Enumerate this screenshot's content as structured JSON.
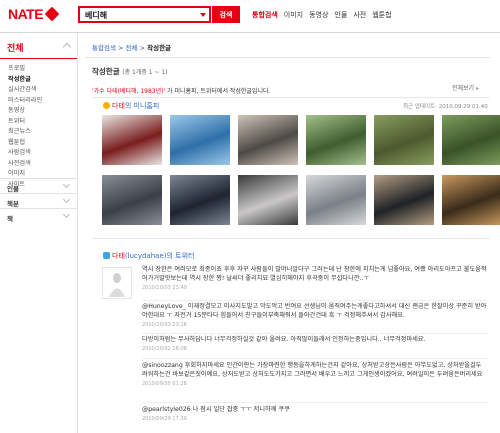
{
  "header": {
    "logo": "NATE",
    "search_value": "베디해",
    "search_button": "검색",
    "nav": [
      {
        "label": "통합검색",
        "active": true
      },
      {
        "label": "이미지",
        "active": false
      },
      {
        "label": "동영상",
        "active": false
      },
      {
        "label": "인물",
        "active": false
      },
      {
        "label": "사전",
        "active": false
      },
      {
        "label": "웹툰헙",
        "active": false
      }
    ]
  },
  "sidebar": {
    "title": "전체",
    "items": [
      {
        "label": "프로필",
        "active": false
      },
      {
        "label": "작성한글",
        "active": true
      },
      {
        "label": "실시간검색",
        "active": false
      },
      {
        "label": "미스터리라인",
        "active": false
      },
      {
        "label": "동영상",
        "active": false
      },
      {
        "label": "트위터",
        "active": false
      },
      {
        "label": "최근뉴스",
        "active": false
      },
      {
        "label": "웹툰헙",
        "active": false
      },
      {
        "label": "사람검색",
        "active": false
      },
      {
        "label": "사전검색",
        "active": false
      },
      {
        "label": "이미지",
        "active": false
      },
      {
        "label": "사이트",
        "active": false
      }
    ],
    "sections": [
      "인물",
      "책분",
      "책"
    ]
  },
  "breadcrumb": {
    "items": [
      "통합검색",
      "전체"
    ],
    "current": "작성한글",
    "sep": ">"
  },
  "result": {
    "title": "작성한글",
    "count": "(총 1개중 1 ~ 1)",
    "expand_all": "전체보기",
    "query_quote": "'가수 다테(베디해, 1983년)'",
    "query_rest": " 가 미니홈피, 트위터에서 작성한글입니다."
  },
  "homepage": {
    "title_hl": "다테",
    "title_rest": "의 미니홈피",
    "date": "최근 업데이트: 2010.09.29 01:40",
    "photo_colors": [
      [
        "#7a1d1f",
        "#e9e6e1",
        "#2f6fa8",
        "#9cc9ea",
        "#4d4a46",
        "#d0c4b8",
        "#3f5e30",
        "#a2c18a",
        "#4b5a2e",
        "#8a9d5f",
        "#3a5228",
        "#7e9d5d"
      ],
      [
        "#3b3f47",
        "#8a8f97",
        "#1e2430",
        "#7d8694",
        "#c9c7c8",
        "#3a3a3a",
        "#7a8087",
        "#d8d8da",
        "#1f2226",
        "#b39e84",
        "#3a2b1a",
        "#c89a5e"
      ]
    ]
  },
  "twitter": {
    "title_hl": "다테",
    "title_rest": "(lucydahae)의 트위터",
    "tweets": [
      {
        "text": "역시 장한은 여러모로 최종이죠 후후 자꾸 사람들이 말머니알다구 그러는데 난 장한에 지치는게 넘좋아요, 여쨌 아리도아프고 불도움적어가거말앗보는데 역시 장한 짱! 날씨더 좋리치묘 열심히해야지 후곡중이 무섭다니깐..ㅜ",
        "date": "2010/10/03 23:40"
      },
      {
        "text": "@HuneyLove_ 이재정결모고 미사지도발고 악도먹고 반여요 선생님이 움직여주는게좋다고하셔서 대신 괜금은 한잘이상 꾸준히 받아야한대요 ㅜ 자전거 15분타다 힘들어서 친구들이부축해줘서 돌아간건데 흑 ㅜ 걱정해주셔서 감사해요.",
        "date": "2010/10/03 23:16"
      },
      {
        "text": "다방이처럼는 무사하답니다 너무걱정하실것 같아 올려요. 아직많이들래서 인정하는중입니다.. 너무걱정마세요.",
        "date": "2010/10/02 16:08"
      },
      {
        "text": "@sinoozzang 후회하지마세요 인간이란는 가장마련한 행동을하게하는건지 같아요, 상처받고상은사람은 아무도없고, 상처받을걸두려워하는건 바보같은짓이예요, 상처도받고 상처도도가지고 그러면서 배우고 느끼고 그게인생이겠어요, 여려일이든 두려움은버리세요",
        "date": "2010/09/30 01:28"
      },
      {
        "text": "@pearlstyle026 나 잠시 일단 잡중 ㅜㅜ 저니하께 쿠쿠",
        "date": "2010/09/29 17:39"
      }
    ]
  }
}
